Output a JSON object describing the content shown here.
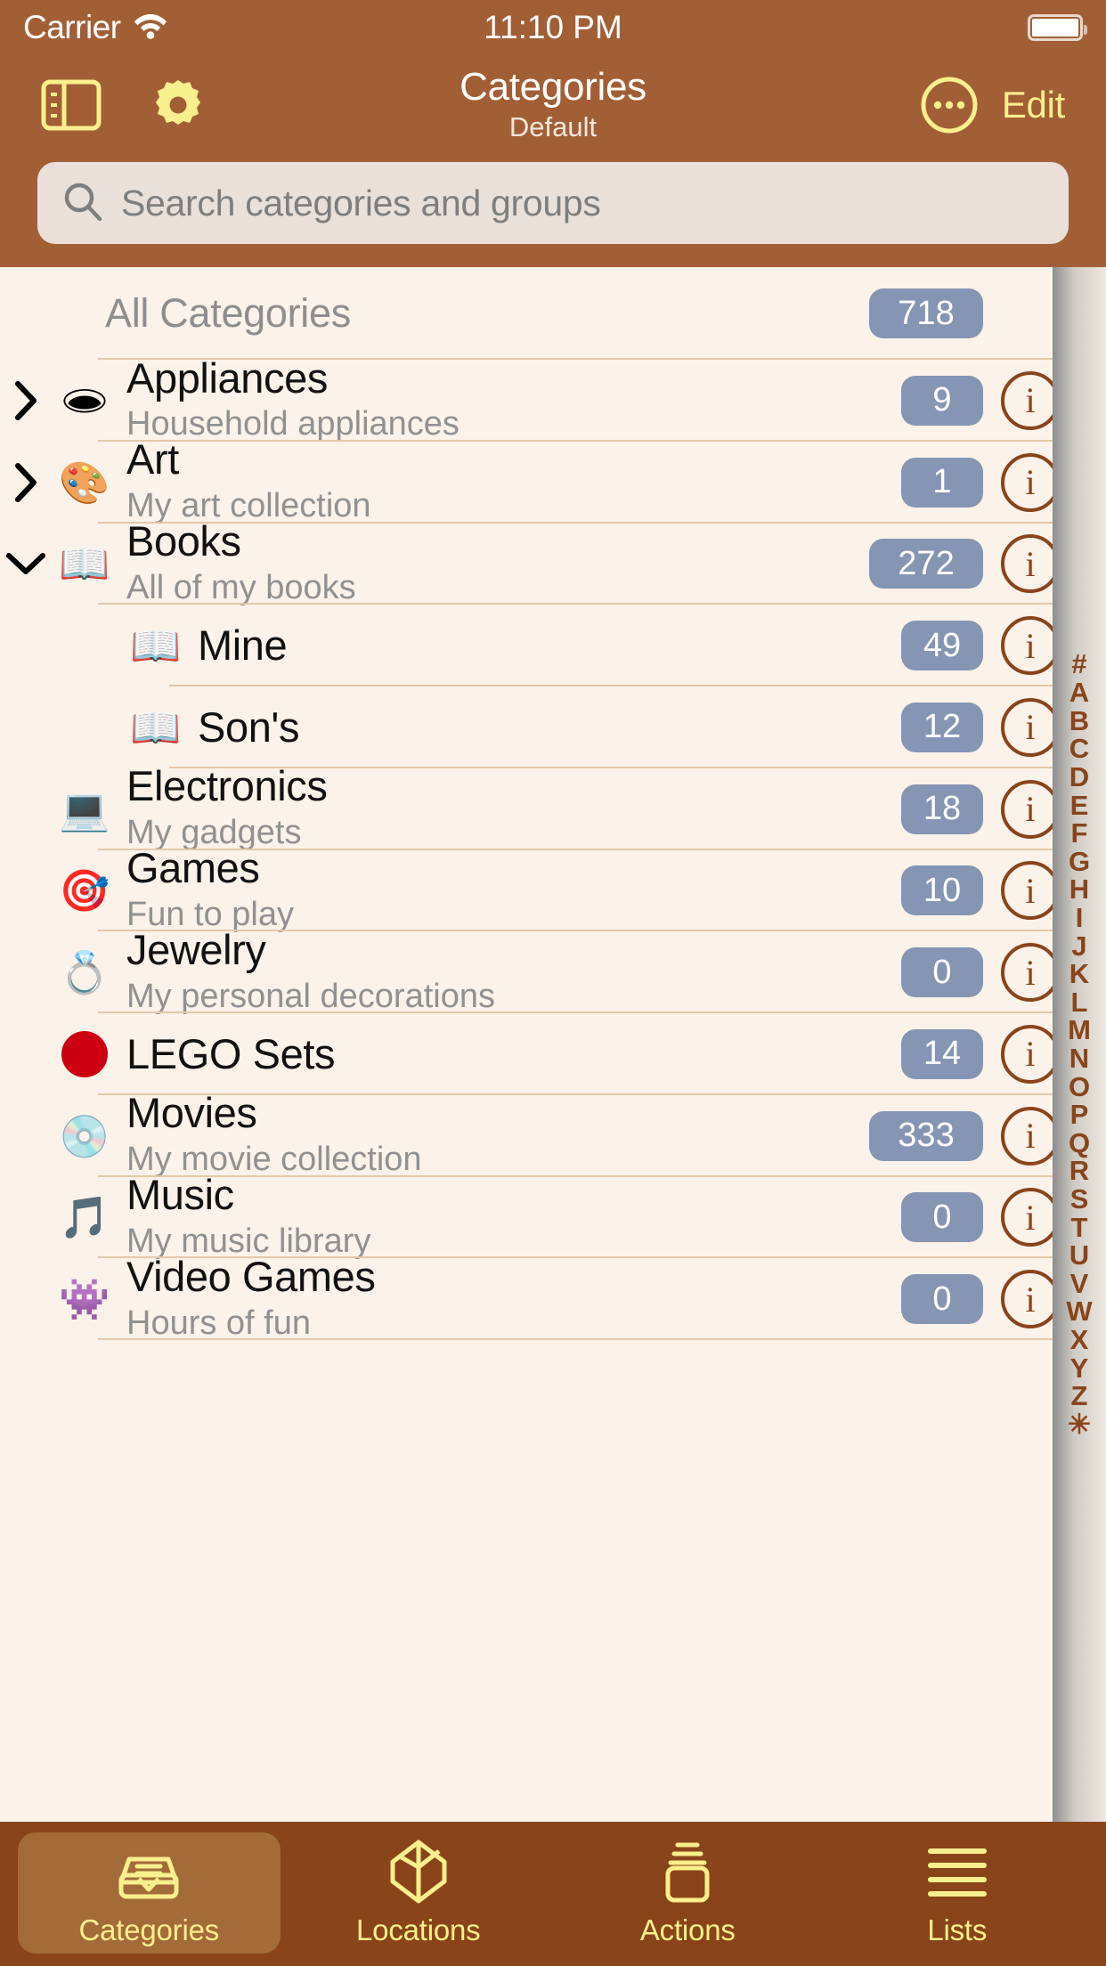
{
  "status_bar": {
    "carrier": "Carrier",
    "wifi_icon": "wifi-icon",
    "time": "11:10 PM",
    "battery_icon": "battery-full-icon"
  },
  "nav_bar": {
    "sidebar_icon": "sidebar-toggle-icon",
    "settings_icon": "gear-icon",
    "title": "Categories",
    "subtitle": "Default",
    "more_icon": "ellipsis-circle-icon",
    "edit_label": "Edit"
  },
  "search": {
    "icon": "search-icon",
    "placeholder": "Search categories and groups",
    "value": ""
  },
  "list": {
    "header": {
      "label": "All Categories",
      "badge": "718"
    },
    "rows": [
      {
        "title": "Appliances",
        "subtitle": "Household appliances",
        "badge": "9",
        "emoji": "🕳",
        "disclosure": "right",
        "child": false,
        "info": "i"
      },
      {
        "title": "Art",
        "subtitle": "My art collection",
        "badge": "1",
        "emoji": "🎨",
        "disclosure": "right",
        "child": false,
        "info": "i"
      },
      {
        "title": "Books",
        "subtitle": "All of my books",
        "badge": "272",
        "emoji": "📖",
        "disclosure": "down",
        "child": false,
        "info": "i"
      },
      {
        "title": "Mine",
        "subtitle": "",
        "badge": "49",
        "emoji": "📖",
        "disclosure": "none",
        "child": true,
        "info": "i"
      },
      {
        "title": "Son's",
        "subtitle": "",
        "badge": "12",
        "emoji": "📖",
        "disclosure": "none",
        "child": true,
        "info": "i"
      },
      {
        "title": "Electronics",
        "subtitle": "My gadgets",
        "badge": "18",
        "emoji": "💻",
        "disclosure": "none",
        "child": false,
        "info": "i"
      },
      {
        "title": "Games",
        "subtitle": "Fun to play",
        "badge": "10",
        "emoji": "🎯",
        "disclosure": "none",
        "child": false,
        "info": "i"
      },
      {
        "title": "Jewelry",
        "subtitle": "My personal decorations",
        "badge": "0",
        "emoji": "💍",
        "disclosure": "none",
        "child": false,
        "info": "i"
      },
      {
        "title": "LEGO Sets",
        "subtitle": "",
        "badge": "14",
        "emoji": "dot",
        "disclosure": "none",
        "child": false,
        "info": "i"
      },
      {
        "title": "Movies",
        "subtitle": "My movie collection",
        "badge": "333",
        "emoji": "💿",
        "disclosure": "none",
        "child": false,
        "info": "i"
      },
      {
        "title": "Music",
        "subtitle": "My music library",
        "badge": "0",
        "emoji": "🎵",
        "disclosure": "none",
        "child": false,
        "info": "i"
      },
      {
        "title": "Video Games",
        "subtitle": "Hours of fun",
        "badge": "0",
        "emoji": "👾",
        "disclosure": "none",
        "child": false,
        "info": "i"
      }
    ]
  },
  "alpha_index": [
    "#",
    "A",
    "B",
    "C",
    "D",
    "E",
    "F",
    "G",
    "H",
    "I",
    "J",
    "K",
    "L",
    "M",
    "N",
    "O",
    "P",
    "Q",
    "R",
    "S",
    "T",
    "U",
    "V",
    "W",
    "X",
    "Y",
    "Z",
    "✳"
  ],
  "tab_bar": {
    "tabs": [
      {
        "label": "Categories",
        "icon": "inbox-tray-icon",
        "active": true
      },
      {
        "label": "Locations",
        "icon": "location-box-icon",
        "active": false
      },
      {
        "label": "Actions",
        "icon": "stacked-box-icon",
        "active": false
      },
      {
        "label": "Lists",
        "icon": "list-lines-icon",
        "active": false
      }
    ]
  },
  "colors": {
    "nav_bg": "#A25F36",
    "tab_bg": "#8A4419",
    "accent_yellow": "#F8F08C",
    "badge_bg": "#8496B4",
    "list_bg": "#FBF2E9",
    "separator": "#E4C9A6",
    "info_brown": "#8A4419"
  }
}
